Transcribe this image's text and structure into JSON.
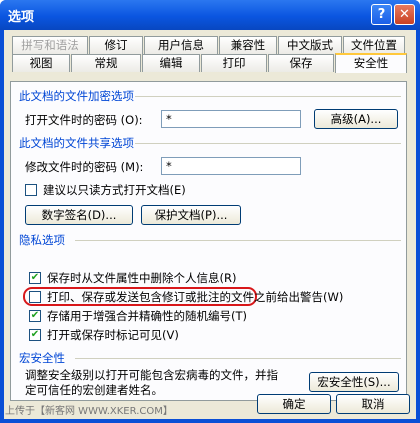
{
  "window": {
    "title": "选项",
    "help_glyph": "?",
    "close_glyph": "✕"
  },
  "tabs_row1": [
    "拼写和语法",
    "修订",
    "用户信息",
    "兼容性",
    "中文版式",
    "文件位置"
  ],
  "tabs_row2": [
    "视图",
    "常规",
    "编辑",
    "打印",
    "保存",
    "安全性"
  ],
  "encrypt": {
    "section": "此文档的文件加密选项",
    "open_label": "打开文件时的密码 (O):",
    "open_value": "*",
    "advanced_button": "高级(A)..."
  },
  "share": {
    "section": "此文档的文件共享选项",
    "modify_label": "修改文件时的密码 (M):",
    "modify_value": "*",
    "readonly_label": "建议以只读方式打开文档(E)",
    "signature_button": "数字签名(D)...",
    "protect_button": "保护文档(P)..."
  },
  "privacy": {
    "section": "隐私选项",
    "items": [
      {
        "label": "保存时从文件属性中删除个人信息(R)",
        "checked": "✔"
      },
      {
        "label": "打印、保存或发送包含修订或批注的文件之前给出警告(W)",
        "checked": ""
      },
      {
        "label": "存储用于增强合并精确性的随机编号(T)",
        "checked": "✔"
      },
      {
        "label": "打开或保存时标记可见(V)",
        "checked": "✔"
      }
    ]
  },
  "macro": {
    "section": "宏安全性",
    "description_line1": "调整安全级别以打开可能包含宏病毒的文件，并指",
    "description_line2": "定可信任的宏创建者姓名。",
    "button": "宏安全性(S)..."
  },
  "footer": {
    "ok": "确定",
    "cancel": "取消",
    "watermark": "上传于【新客网 WWW.XKER.COM】"
  },
  "colors": {
    "title_bar": "#0a55e0",
    "section_text": "#0046d5",
    "highlight": "#d8171a"
  }
}
